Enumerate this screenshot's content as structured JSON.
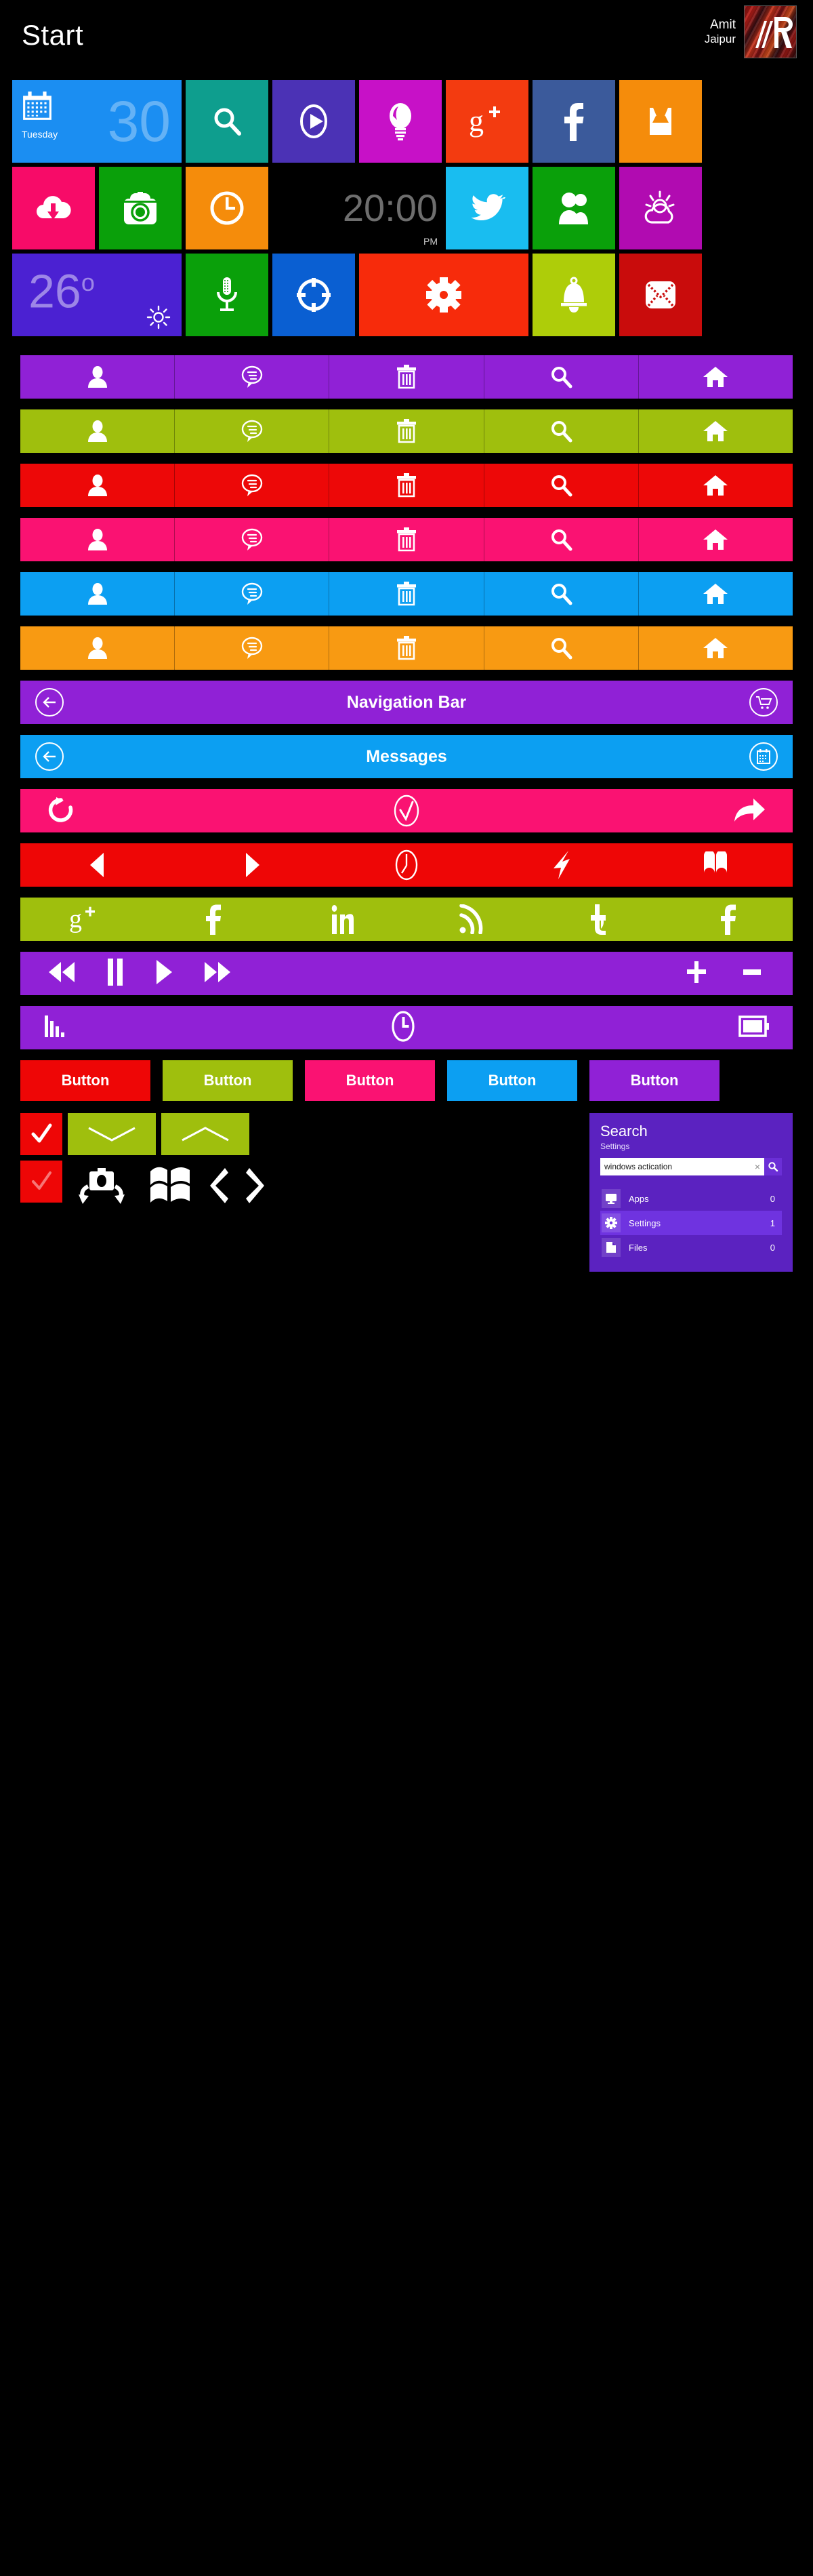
{
  "header": {
    "start_label": "Start",
    "user_name": "Amit",
    "user_city": "Jaipur",
    "avatar_name": "user-avatar-logo"
  },
  "tiles": {
    "row1": [
      {
        "name": "calendar-tile",
        "icon": "calendar-icon",
        "color": "#1b8ef2",
        "width": "wd",
        "day_label": "Tuesday",
        "date_number": "30"
      },
      {
        "name": "search-tile",
        "icon": "search-icon",
        "color": "#0e9e8e",
        "width": "sq"
      },
      {
        "name": "video-tile",
        "icon": "play-circle-icon",
        "color": "#4b32b5",
        "width": "sq"
      },
      {
        "name": "ideas-tile",
        "icon": "lightbulb-icon",
        "color": "#c711c7",
        "width": "sq"
      },
      {
        "name": "google-plus-tile",
        "icon": "google-plus-icon",
        "color": "#f33b10",
        "width": "sq"
      },
      {
        "name": "facebook-tile",
        "icon": "facebook-icon",
        "color": "#3b5a9b",
        "width": "sq"
      },
      {
        "name": "inbox-tile",
        "icon": "inbox-icon",
        "color": "#f58c0b",
        "width": "sq"
      }
    ],
    "row2": [
      {
        "name": "cloud-download-tile",
        "icon": "cloud-download-icon",
        "color": "#f70b68",
        "width": "sq"
      },
      {
        "name": "camera-tile",
        "icon": "camera-icon",
        "color": "#0aa00a",
        "width": "sq"
      },
      {
        "name": "alarm-tile",
        "icon": "clock-icon",
        "color": "#f58c0b",
        "width": "sq"
      },
      {
        "name": "clock-tile",
        "icon": "digital-clock",
        "color": "#000000",
        "width": "wd",
        "time": "20:00",
        "ampm": "PM"
      },
      {
        "name": "twitter-tile",
        "icon": "twitter-bird-icon",
        "color": "#19bdf0",
        "width": "sq"
      },
      {
        "name": "people-tile",
        "icon": "people-icon",
        "color": "#0aa00a",
        "width": "sq"
      },
      {
        "name": "weather-tile",
        "icon": "sun-cloud-icon",
        "color": "#b10bb1",
        "width": "sq"
      }
    ],
    "row3": [
      {
        "name": "temperature-tile",
        "icon": "sun-icon",
        "color": "#4b21d2",
        "width": "wd",
        "temperature": "26",
        "degree": "o"
      },
      {
        "name": "microphone-tile",
        "icon": "microphone-icon",
        "color": "#0aa00a",
        "width": "sq"
      },
      {
        "name": "location-tile",
        "icon": "target-icon",
        "color": "#0a5fd2",
        "width": "sq"
      },
      {
        "name": "settings-tile",
        "icon": "gear-icon",
        "color": "#f72b0b",
        "width": "wd"
      },
      {
        "name": "notifications-tile",
        "icon": "bell-icon",
        "color": "#aecd09",
        "width": "sq"
      },
      {
        "name": "mail-tile",
        "icon": "envelope-icon",
        "color": "#c90c0c",
        "width": "sq"
      }
    ]
  },
  "icon_toolbars": [
    {
      "name": "toolbar-purple",
      "color": "#9021d6",
      "icons": [
        "person-icon",
        "chat-bubble-icon",
        "trash-icon",
        "search-icon",
        "home-icon"
      ]
    },
    {
      "name": "toolbar-lime",
      "color": "#9fbf0d",
      "icons": [
        "person-icon",
        "chat-bubble-icon",
        "trash-icon",
        "search-icon",
        "home-icon"
      ]
    },
    {
      "name": "toolbar-red",
      "color": "#ed0808",
      "icons": [
        "person-icon",
        "chat-bubble-icon",
        "trash-icon",
        "search-icon",
        "home-icon"
      ]
    },
    {
      "name": "toolbar-pink",
      "color": "#fa1272",
      "icons": [
        "person-icon",
        "chat-bubble-icon",
        "trash-icon",
        "search-icon",
        "home-icon"
      ]
    },
    {
      "name": "toolbar-blue",
      "color": "#0c9ff2",
      "icons": [
        "person-icon",
        "chat-bubble-icon",
        "trash-icon",
        "search-icon",
        "home-icon"
      ]
    },
    {
      "name": "toolbar-orange",
      "color": "#f89a12",
      "icons": [
        "person-icon",
        "chat-bubble-icon",
        "trash-icon",
        "search-icon",
        "home-icon"
      ]
    }
  ],
  "nav_bars": [
    {
      "name": "navigation-bar",
      "title": "Navigation Bar",
      "color": "#9021d6",
      "left_icon": "back-arrow-circle-icon",
      "right_icon": "shopping-cart-circle-icon"
    },
    {
      "name": "messages-bar",
      "title": "Messages",
      "color": "#0c9ff2",
      "left_icon": "back-arrow-circle-icon",
      "right_icon": "calendar-circle-icon"
    }
  ],
  "action_bars": [
    {
      "name": "refresh-bar",
      "color": "#fa1272",
      "icons": [
        "refresh-icon",
        "check-circle-icon",
        "share-arrow-icon"
      ]
    },
    {
      "name": "browser-bar",
      "color": "#ee0606",
      "icons": [
        "previous-triangle-icon",
        "next-triangle-icon",
        "clock-icon",
        "navigate-icon",
        "book-icon"
      ]
    }
  ],
  "social_bar": {
    "name": "social-bar",
    "color": "#9fbf0d",
    "icons": [
      "google-plus-icon",
      "facebook-icon",
      "linkedin-icon",
      "rss-icon",
      "twitter-t-icon",
      "facebook-icon"
    ]
  },
  "media_bar": {
    "name": "media-player-bar",
    "color": "#9021d6",
    "left_icons": [
      "rewind-icon",
      "pause-icon",
      "play-icon",
      "fast-forward-icon"
    ],
    "right_icons": [
      "plus-icon",
      "minus-icon"
    ]
  },
  "status_bar": {
    "name": "status-bar",
    "color": "#9021d6",
    "icons": [
      "signal-bars-icon",
      "clock-icon",
      "battery-icon"
    ]
  },
  "buttons": [
    {
      "name": "button-red",
      "label": "Button",
      "color": "#ee0606"
    },
    {
      "name": "button-lime",
      "label": "Button",
      "color": "#9fbf0d"
    },
    {
      "name": "button-pink",
      "label": "Button",
      "color": "#fa1272"
    },
    {
      "name": "button-blue",
      "label": "Button",
      "color": "#0c9ff2"
    },
    {
      "name": "button-purple",
      "label": "Button",
      "color": "#9021d6"
    }
  ],
  "controls": {
    "checkbox_checked": {
      "name": "checkbox-checked",
      "icon": "check-icon",
      "color": "#ee0606"
    },
    "checkbox_unchecked": {
      "name": "checkbox-dimmed",
      "icon": "check-icon",
      "color": "#ee0606"
    },
    "chevron_down": {
      "name": "chevron-down-button",
      "icon": "chevron-down-icon",
      "color": "#9fbf0d"
    },
    "chevron_up": {
      "name": "chevron-up-button",
      "icon": "chevron-up-icon",
      "color": "#9fbf0d"
    },
    "glyphs": [
      "rotate-camera-icon",
      "windows-logo-icon",
      "chevron-left-icon",
      "chevron-right-icon"
    ]
  },
  "search": {
    "heading": "Search",
    "subheading": "Settings",
    "query": "windows actication",
    "placeholder": "Search",
    "clear_label": "×",
    "go_icon": "search-icon",
    "accent": "#5b22c0",
    "results": [
      {
        "name": "search-result-apps",
        "icon": "monitor-icon",
        "label": "Apps",
        "count": "0",
        "active": false
      },
      {
        "name": "search-result-settings",
        "icon": "gear-icon",
        "label": "Settings",
        "count": "1",
        "active": true
      },
      {
        "name": "search-result-files",
        "icon": "document-icon",
        "label": "Files",
        "count": "0",
        "active": false
      }
    ]
  }
}
